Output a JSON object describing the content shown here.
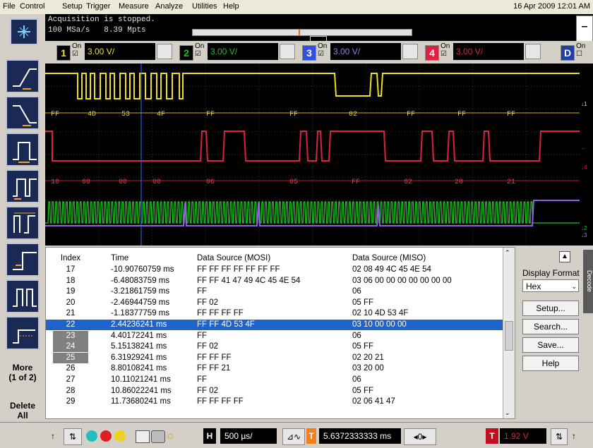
{
  "menu": {
    "items": [
      "File",
      "Control",
      "Setup",
      "Trigger",
      "Measure",
      "Analyze",
      "Utilities",
      "Help"
    ],
    "date": "16 Apr 2009 12:01 AM"
  },
  "acquisition": {
    "status": "Acquisition is stopped.",
    "rate": "100 MSa/s",
    "memory": "8.39 Mpts"
  },
  "channels": [
    {
      "num": "1",
      "on_label": "On",
      "scale": "3.00 V/",
      "color": "#f0e020"
    },
    {
      "num": "2",
      "on_label": "On",
      "scale": "3.00 V/",
      "color": "#20c020"
    },
    {
      "num": "3",
      "on_label": "On",
      "scale": "3.00 V/",
      "color": "#3050e0"
    },
    {
      "num": "4",
      "on_label": "On",
      "scale": "3.00 V/",
      "color": "#e02040"
    }
  ],
  "digital": {
    "label": "D",
    "on_label": "On"
  },
  "decode": {
    "mosi_labels": [
      "FF",
      "4D",
      "53",
      "4F",
      "FF",
      "FF",
      "02",
      "FF",
      "FF",
      "FF"
    ],
    "miso_labels": [
      "10",
      "00",
      "00",
      "00",
      "06",
      "05",
      "FF",
      "02",
      "20",
      "21"
    ]
  },
  "table": {
    "headers": [
      "Index",
      "Time",
      "Data Source (MOSI)",
      "Data Source (MISO)"
    ],
    "rows": [
      {
        "index": "17",
        "time": "-10.90760759 ms",
        "mosi": "FF FF FF FF FF FF FF",
        "miso": "02 08 49 4C 45 4E 54"
      },
      {
        "index": "18",
        "time": "-6.48083759 ms",
        "mosi": "FF FF 41 47 49 4C 45 4E 54",
        "miso": "03 06 00 00 00 00 00 00 00"
      },
      {
        "index": "19",
        "time": "-3.21861759 ms",
        "mosi": "FF",
        "miso": "06"
      },
      {
        "index": "20",
        "time": "-2.46944759 ms",
        "mosi": "FF 02",
        "miso": "05 FF"
      },
      {
        "index": "21",
        "time": "-1.18377759 ms",
        "mosi": "FF FF FF FF",
        "miso": "02 10 4D 53 4F"
      },
      {
        "index": "22",
        "time": "2.44236241 ms",
        "mosi": "FF FF 4D 53 4F",
        "miso": "03 10 00 00 00"
      },
      {
        "index": "23",
        "time": "4.40172241 ms",
        "mosi": "FF",
        "miso": "06"
      },
      {
        "index": "24",
        "time": "5.15138241 ms",
        "mosi": "FF 02",
        "miso": "05 FF"
      },
      {
        "index": "25",
        "time": "6.31929241 ms",
        "mosi": "FF FF FF",
        "miso": "02 20 21"
      },
      {
        "index": "26",
        "time": "8.80108241 ms",
        "mosi": "FF FF 21",
        "miso": "03 20 00"
      },
      {
        "index": "27",
        "time": "10.11021241 ms",
        "mosi": "FF",
        "miso": "06"
      },
      {
        "index": "28",
        "time": "10.86022241 ms",
        "mosi": "FF 02",
        "miso": "05 FF"
      },
      {
        "index": "29",
        "time": "11.73680241 ms",
        "mosi": "FF FF FF FF",
        "miso": "02 06 41 47"
      }
    ],
    "selected_index": "22"
  },
  "right_panel": {
    "display_format_label": "Display Format",
    "format_value": "Hex",
    "setup": "Setup...",
    "search": "Search...",
    "save": "Save...",
    "help": "Help",
    "decode_tab": "Decode"
  },
  "side_buttons": {
    "more": "More",
    "more_page": "(1 of 2)",
    "delete": "Delete",
    "all": "All"
  },
  "bottom": {
    "h_label": "H",
    "timebase": "500 µs/",
    "delay": "5.6372333333 ms",
    "nav_value": "0",
    "t_label": "T",
    "trig_level": "1.92 V"
  }
}
